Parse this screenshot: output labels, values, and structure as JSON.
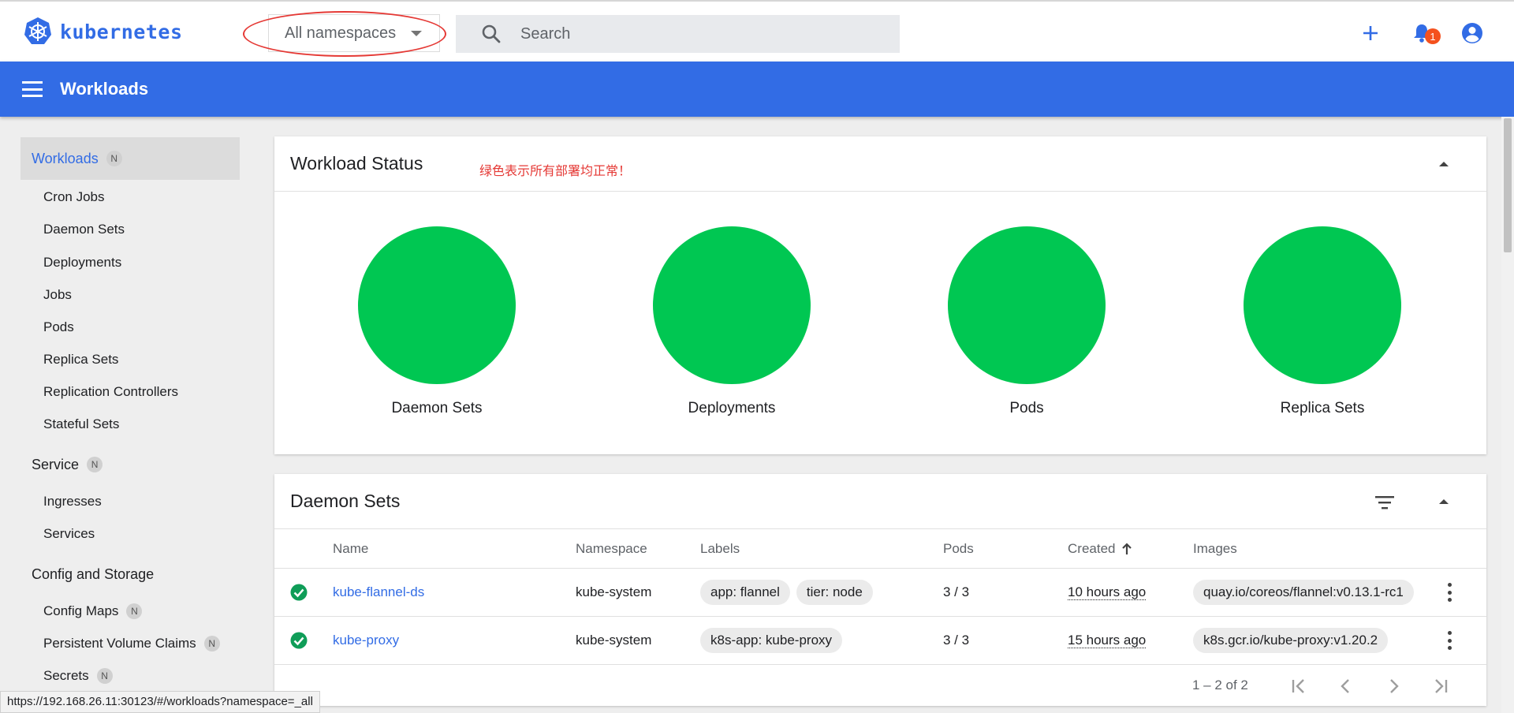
{
  "header": {
    "logo_text": "kubernetes",
    "namespace": {
      "selected": "All namespaces"
    },
    "search": {
      "placeholder": "Search"
    },
    "notifications_count": "1"
  },
  "toolbar": {
    "title": "Workloads"
  },
  "sidebar": {
    "sections": [
      {
        "label": "Workloads",
        "badge": "N",
        "active": true
      },
      {
        "label": "Service",
        "badge": "N"
      },
      {
        "label": "Config and Storage"
      }
    ],
    "workload_items": [
      "Cron Jobs",
      "Daemon Sets",
      "Deployments",
      "Jobs",
      "Pods",
      "Replica Sets",
      "Replication Controllers",
      "Stateful Sets"
    ],
    "service_items": [
      "Ingresses",
      "Services"
    ],
    "config_items": [
      {
        "label": "Config Maps",
        "badge": "N"
      },
      {
        "label": "Persistent Volume Claims",
        "badge": "N"
      },
      {
        "label": "Secrets",
        "badge": "N"
      }
    ]
  },
  "workload_status": {
    "title": "Workload Status",
    "note": "绿色表示所有部署均正常！",
    "status_color": "#00c752",
    "items": [
      "Daemon Sets",
      "Deployments",
      "Pods",
      "Replica Sets"
    ]
  },
  "daemon_sets": {
    "title": "Daemon Sets",
    "columns": {
      "name": "Name",
      "namespace": "Namespace",
      "labels": "Labels",
      "pods": "Pods",
      "created": "Created",
      "images": "Images"
    },
    "rows": [
      {
        "name": "kube-flannel-ds",
        "namespace": "kube-system",
        "labels": [
          "app: flannel",
          "tier: node"
        ],
        "pods": "3 / 3",
        "created": "10 hours ago",
        "image": "quay.io/coreos/flannel:v0.13.1-rc1"
      },
      {
        "name": "kube-proxy",
        "namespace": "kube-system",
        "labels": [
          "k8s-app: kube-proxy"
        ],
        "pods": "3 / 3",
        "created": "15 hours ago",
        "image": "k8s.gcr.io/kube-proxy:v1.20.2"
      }
    ],
    "pagination": "1 – 2 of 2"
  },
  "statusbar": {
    "url": "https://192.168.26.11:30123/#/workloads?namespace=_all"
  },
  "colors": {
    "primary": "#326ce5",
    "ok": "#0f9d58",
    "annotation": "#e53935"
  }
}
